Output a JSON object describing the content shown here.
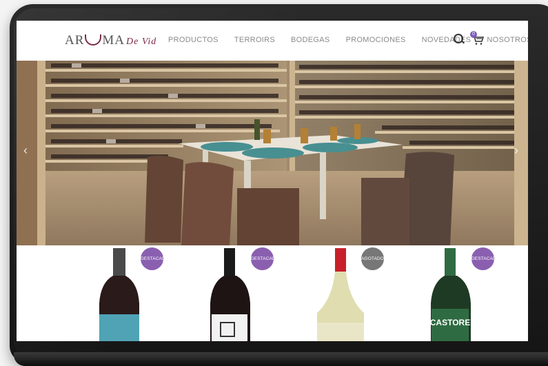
{
  "brand": {
    "logo_main": "AR",
    "logo_rest": "MA",
    "logo_script": "De Vid"
  },
  "nav": {
    "items": [
      "PRODUCTOS",
      "TERROIRS",
      "BODEGAS",
      "PROMOCIONES",
      "NOVEDADES",
      "NOSOTROS"
    ]
  },
  "cart": {
    "count": "0"
  },
  "hero": {
    "prev": "‹",
    "next": "›"
  },
  "products": [
    {
      "badge": "DESTACADO",
      "badge_color": "#8a5fb0",
      "label_color": "#4fa3b4"
    },
    {
      "badge": "DESTACADO",
      "badge_color": "#8a5fb0",
      "label_color": "#f2f2f2"
    },
    {
      "badge": "AGOTADO",
      "badge_color": "#777777",
      "label_color": "#e9e6c8"
    },
    {
      "badge": "DESTACADO",
      "badge_color": "#8a5fb0",
      "label_color": "#2f6b42",
      "label_text": "CASTORE"
    }
  ],
  "colors": {
    "brand": "#7a2a4a",
    "accent": "#8a5fb0"
  }
}
